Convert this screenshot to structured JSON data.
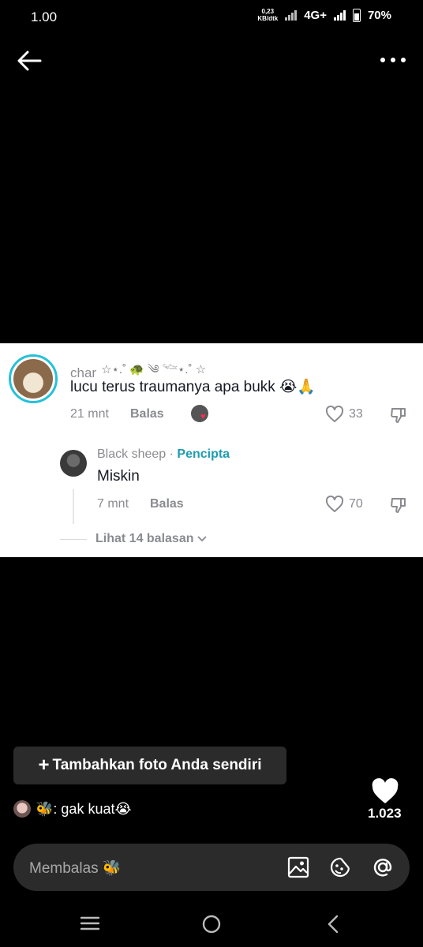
{
  "status_bar": {
    "time": "1.00",
    "speed_value": "0,23",
    "speed_unit": "KB/dtk",
    "network": "4G+",
    "battery": "70%"
  },
  "comment": {
    "username": "char",
    "username_deco": "☆⋆.˚ 🐢 ༄ 𓆝⋆.˚ ☆",
    "text": "lucu terus traumanya apa bukk 😭🙏",
    "time": "21 mnt",
    "reply_label": "Balas",
    "like_count": "33"
  },
  "reply": {
    "username": "Black sheep",
    "separator": " · ",
    "creator_label": "Pencipta",
    "text": "Miskin",
    "time": "7 mnt",
    "reply_label": "Balas",
    "like_count": "70"
  },
  "view_more": "Lihat 14 balasan",
  "add_photo": {
    "plus": "+",
    "label": "Tambahkan foto Anda sendiri"
  },
  "caption": {
    "emoji": "🐝",
    "text": ": gak kuat😭"
  },
  "likes": "1.023",
  "reply_input": {
    "placeholder": "Membalas 🐝"
  },
  "colors": {
    "accent_creator": "#1f9db0",
    "avatar_ring": "#25c1d8",
    "heart_red": "#fe2c55"
  }
}
